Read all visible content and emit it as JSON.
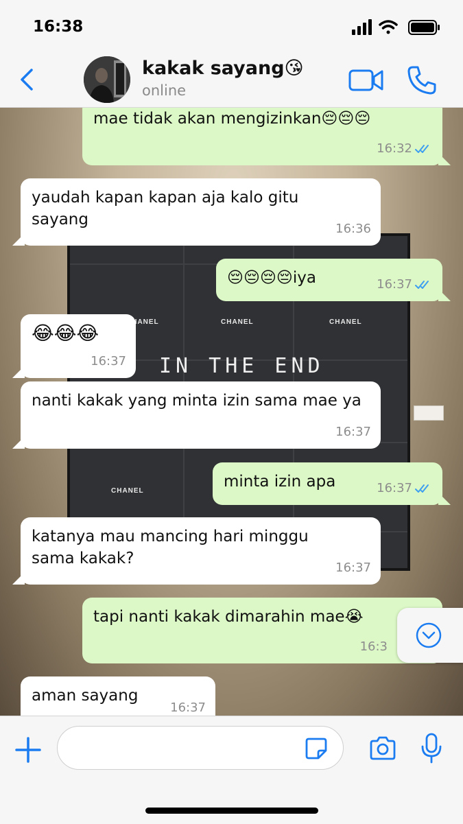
{
  "status_bar": {
    "time": "16:38"
  },
  "header": {
    "contact_name": "kakak sayang😘",
    "status": "online"
  },
  "messages": [
    {
      "dir": "out",
      "text": "mae tidak akan mengizinkan😔😔😔",
      "time": "16:32",
      "read": true
    },
    {
      "dir": "in",
      "text": "yaudah kapan kapan aja kalo gitu sayang",
      "time": "16:36"
    },
    {
      "dir": "out",
      "text": "😔😔😔😔iya",
      "time": "16:37",
      "read": true
    },
    {
      "dir": "in",
      "text": "😂😂😂",
      "time": "16:37"
    },
    {
      "dir": "in",
      "text": "nanti kakak yang minta izin sama mae ya",
      "time": "16:37"
    },
    {
      "dir": "out",
      "text": "minta izin apa",
      "time": "16:37",
      "read": true
    },
    {
      "dir": "in",
      "text": "katanya mau mancing hari minggu sama kakak?",
      "time": "16:37"
    },
    {
      "dir": "out",
      "text": "tapi nanti kakak dimarahin mae😭",
      "time": "16:3"
    },
    {
      "dir": "in",
      "text": "aman sayang",
      "time": "16:37"
    }
  ],
  "wallpaper": {
    "brand_labels": [
      "CHANEL",
      "CHANEL",
      "CHANEL",
      "CHANEL"
    ],
    "scrawl": "IN THE END"
  },
  "input": {
    "placeholder": ""
  },
  "colors": {
    "accent": "#1a7cf0",
    "outgoing_bubble": "#dcf8c6",
    "incoming_bubble": "#ffffff",
    "read_ticks": "#3e9ff0"
  }
}
